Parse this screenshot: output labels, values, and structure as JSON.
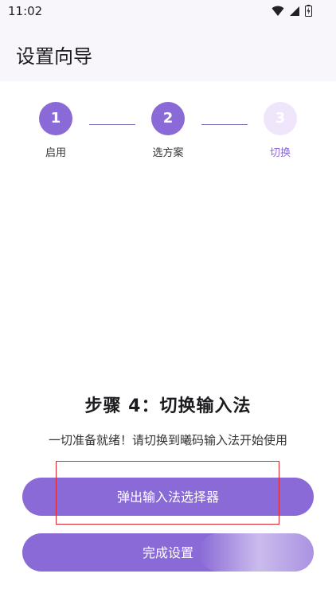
{
  "status_bar": {
    "time": "11:02"
  },
  "app_bar": {
    "title": "设置向导"
  },
  "stepper": {
    "steps": [
      {
        "number": "1",
        "label": "启用"
      },
      {
        "number": "2",
        "label": "选方案"
      },
      {
        "number": "3",
        "label": "切换"
      }
    ]
  },
  "content": {
    "title": "步骤 4：切换输入法",
    "subtitle": "一切准备就绪！请切换到曦码输入法开始使用"
  },
  "buttons": {
    "popup_picker": "弹出输入法选择器",
    "finish": "完成设置"
  },
  "colors": {
    "accent": "#8a6ad6",
    "accent_light": "#efe6fb",
    "highlight": "#e0262e"
  }
}
